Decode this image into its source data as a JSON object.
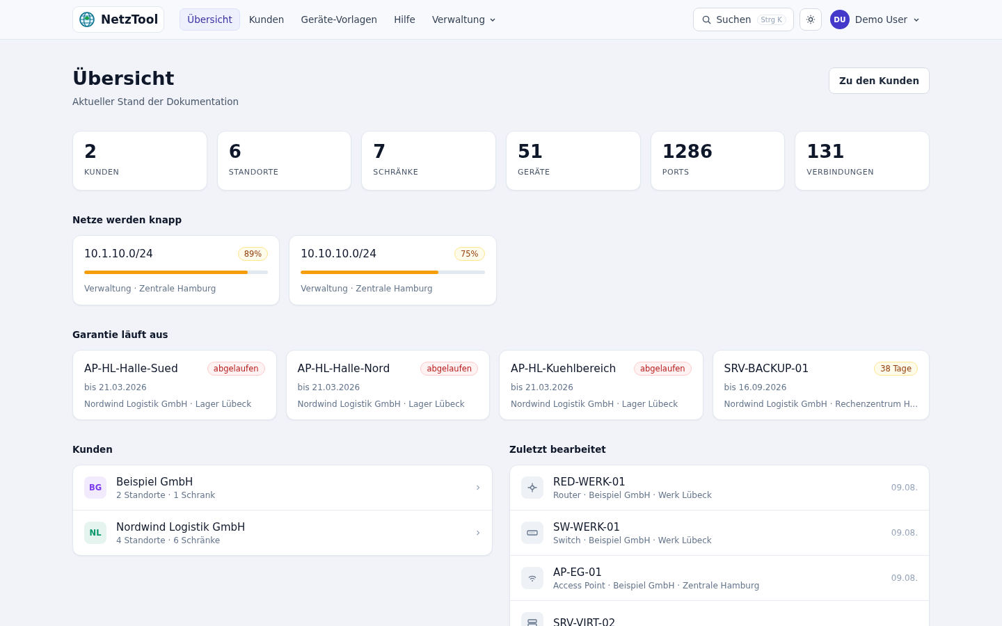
{
  "brand": {
    "name": "NetzTool"
  },
  "nav": [
    {
      "label": "Übersicht",
      "selected": true,
      "dropdown": false
    },
    {
      "label": "Kunden",
      "selected": false,
      "dropdown": false
    },
    {
      "label": "Geräte-Vorlagen",
      "selected": false,
      "dropdown": false
    },
    {
      "label": "Hilfe",
      "selected": false,
      "dropdown": false
    },
    {
      "label": "Verwaltung",
      "selected": false,
      "dropdown": true
    }
  ],
  "search": {
    "label": "Suchen",
    "shortcut": "Strg K"
  },
  "user": {
    "initials": "DU",
    "name": "Demo User"
  },
  "page": {
    "title": "Übersicht",
    "subtitle": "Aktueller Stand der Dokumentation",
    "action": "Zu den Kunden"
  },
  "stats": [
    {
      "value": "2",
      "label": "KUNDEN"
    },
    {
      "value": "6",
      "label": "STANDORTE"
    },
    {
      "value": "7",
      "label": "SCHRÄNKE"
    },
    {
      "value": "51",
      "label": "GERÄTE"
    },
    {
      "value": "1286",
      "label": "PORTS"
    },
    {
      "value": "131",
      "label": "VERBINDUNGEN"
    }
  ],
  "subnets": {
    "title": "Netze werden knapp",
    "items": [
      {
        "name": "10.1.10.0/24",
        "badge": "89%",
        "level": 0.89,
        "location": "Verwaltung · Zentrale Hamburg"
      },
      {
        "name": "10.10.10.0/24",
        "badge": "75%",
        "level": 0.75,
        "location": "Verwaltung · Zentrale Hamburg"
      }
    ]
  },
  "warranty": {
    "title": "Garantie läuft aus",
    "items": [
      {
        "name": "AP-HL-Halle-Sued",
        "badge": "abgelaufen",
        "kind": "expired",
        "date": "bis 21.03.2026",
        "location": "Nordwind Logistik GmbH · Lager Lübeck"
      },
      {
        "name": "AP-HL-Halle-Nord",
        "badge": "abgelaufen",
        "kind": "expired",
        "date": "bis 21.03.2026",
        "location": "Nordwind Logistik GmbH · Lager Lübeck"
      },
      {
        "name": "AP-HL-Kuehlbereich",
        "badge": "abgelaufen",
        "kind": "expired",
        "date": "bis 21.03.2026",
        "location": "Nordwind Logistik GmbH · Lager Lübeck"
      },
      {
        "name": "SRV-BACKUP-01",
        "badge": "38 Tage",
        "kind": "soon",
        "date": "bis 16.09.2026",
        "location": "Nordwind Logistik GmbH · Rechenzentrum H..."
      }
    ]
  },
  "customers": {
    "title": "Kunden",
    "items": [
      {
        "initials": "BG",
        "color": "#7c3aed",
        "name": "Beispiel GmbH",
        "detail": "2 Standorte · 1 Schrank"
      },
      {
        "initials": "NL",
        "color": "#059669",
        "name": "Nordwind Logistik GmbH",
        "detail": "4 Standorte · 6 Schränke"
      }
    ]
  },
  "recent": {
    "title": "Zuletzt bearbeitet",
    "items": [
      {
        "kind": "router",
        "name": "RED-WERK-01",
        "detail": "Router · Beispiel GmbH · Werk Lübeck",
        "date": "09.08."
      },
      {
        "kind": "switch",
        "name": "SW-WERK-01",
        "detail": "Switch · Beispiel GmbH · Werk Lübeck",
        "date": "09.08."
      },
      {
        "kind": "ap",
        "name": "AP-EG-01",
        "detail": "Access Point · Beispiel GmbH · Zentrale Hamburg",
        "date": "09.08."
      },
      {
        "kind": "server",
        "name": "SRV-VIRT-02"
      }
    ]
  }
}
